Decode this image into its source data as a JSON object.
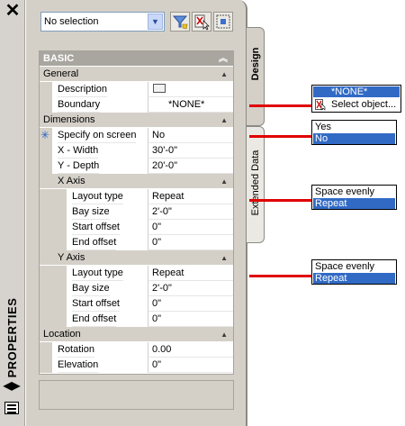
{
  "palette": {
    "title": "PROPERTIES",
    "close": "✕"
  },
  "selection": {
    "value": "No selection"
  },
  "sections": {
    "basic": "BASIC",
    "general": "General",
    "dimensions": "Dimensions",
    "x_axis": "X Axis",
    "y_axis": "Y Axis",
    "location": "Location"
  },
  "general": [
    {
      "name": "Description",
      "value": ""
    },
    {
      "name": "Boundary",
      "value": "*NONE*"
    }
  ],
  "dimensions": [
    {
      "name": "Specify on screen",
      "value": "No"
    },
    {
      "name": "X - Width",
      "value": "30'-0\""
    },
    {
      "name": "Y - Depth",
      "value": "20'-0\""
    }
  ],
  "x_axis": [
    {
      "name": "Layout type",
      "value": "Repeat"
    },
    {
      "name": "Bay size",
      "value": "2'-0\""
    },
    {
      "name": "Start offset",
      "value": "0\""
    },
    {
      "name": "End offset",
      "value": "0\""
    }
  ],
  "y_axis": [
    {
      "name": "Layout type",
      "value": "Repeat"
    },
    {
      "name": "Bay size",
      "value": "2'-0\""
    },
    {
      "name": "Start offset",
      "value": "0\""
    },
    {
      "name": "End offset",
      "value": "0\""
    }
  ],
  "location": [
    {
      "name": "Rotation",
      "value": "0.00"
    },
    {
      "name": "Elevation",
      "value": "0\""
    }
  ],
  "tabs": {
    "design": "Design",
    "extended": "Extended Data"
  },
  "callouts": {
    "boundary": [
      "*NONE*",
      "Select object..."
    ],
    "specify": [
      "Yes",
      "No"
    ],
    "x_layout": [
      "Space evenly",
      "Repeat"
    ],
    "y_layout": [
      "Space evenly",
      "Repeat"
    ]
  },
  "colors": {
    "callout_line": "#e00000",
    "highlight": "#316ac5"
  }
}
